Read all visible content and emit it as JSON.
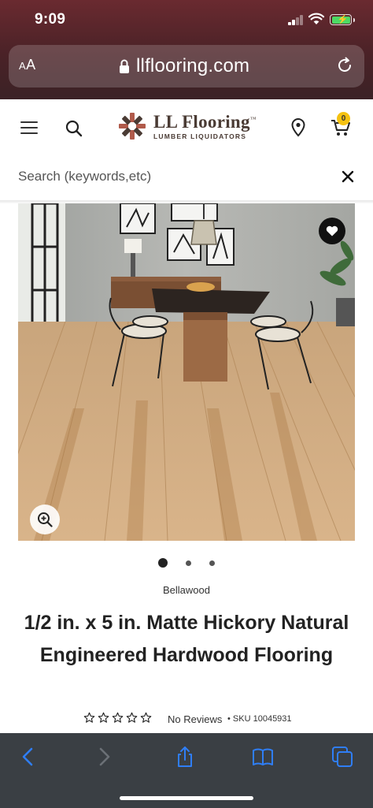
{
  "status_bar": {
    "time": "9:09"
  },
  "browser": {
    "text_size_label": "AA",
    "url": "llflooring.com"
  },
  "site": {
    "logo_title": "LL Flooring",
    "logo_subtitle": "LUMBER LIQUIDATORS",
    "cart_count": "0",
    "search_placeholder": "Search (keywords,etc)"
  },
  "product": {
    "brand": "Bellawood",
    "title": "1/2 in. x 5 in. Matte Hickory Natural Engineered Hardwood Flooring",
    "rating_stars": 0,
    "reviews_label": "No Reviews",
    "sku_label": "SKU 10045931",
    "image_count": 3,
    "active_image": 1
  },
  "colors": {
    "brand_brown": "#4a3b34",
    "brand_accent": "#b05a4a",
    "cart_badge": "#f5c211",
    "safari_tint": "#4a2227",
    "toolbar_bg": "#3a3f44",
    "toolbar_icon": "#2f7ef6"
  },
  "icons": {
    "menu": "hamburger-icon",
    "search": "search-icon",
    "location": "location-pin-icon",
    "cart": "cart-icon",
    "close": "close-icon",
    "wishlist": "heart-icon",
    "zoom": "zoom-in-icon"
  }
}
